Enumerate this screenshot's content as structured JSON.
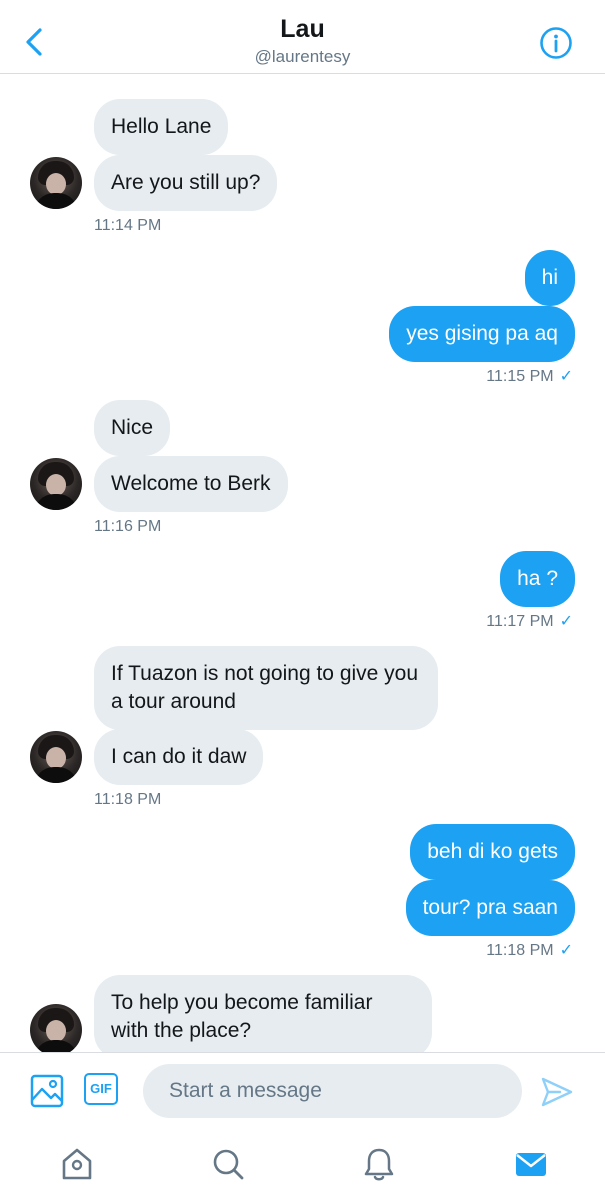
{
  "header": {
    "title": "Lau",
    "handle": "@laurentesy",
    "back_icon": "chevron-left-icon",
    "info_icon": "info-icon"
  },
  "messages": [
    {
      "side": "in",
      "text": "Hello Lane"
    },
    {
      "side": "in",
      "text": "Are you still up?"
    },
    {
      "time": "11:14 PM"
    },
    {
      "side": "out",
      "text": "hi"
    },
    {
      "side": "out",
      "text": "yes gising pa aq"
    },
    {
      "time": "11:15 PM",
      "read": "✓"
    },
    {
      "side": "in",
      "text": "Nice"
    },
    {
      "side": "in",
      "text": "Welcome to Berk"
    },
    {
      "time": "11:16 PM"
    },
    {
      "side": "out",
      "text": "ha ?"
    },
    {
      "time": "11:17 PM",
      "read": "✓"
    },
    {
      "side": "in",
      "text": "If Tuazon is not going to give you a tour around"
    },
    {
      "side": "in",
      "text": "I can do it daw"
    },
    {
      "time": "11:18 PM"
    },
    {
      "side": "out",
      "text": "beh di ko gets"
    },
    {
      "side": "out",
      "text": "tour? pra saan"
    },
    {
      "time": "11:18 PM",
      "read": "✓"
    },
    {
      "side": "in",
      "text": "To help you become familiar with the place?"
    }
  ],
  "composer": {
    "placeholder": "Start a message",
    "gif_label": "GIF",
    "media_icon": "image-icon",
    "send_icon": "send-icon"
  },
  "tabbar": {
    "items": [
      "home-icon",
      "search-icon",
      "notifications-icon",
      "messages-icon"
    ],
    "active": "messages-icon"
  },
  "colors": {
    "accent": "#1da1f2",
    "incoming_bubble": "#e6ecf0",
    "muted_text": "#657786",
    "icon_gray": "#657786"
  }
}
